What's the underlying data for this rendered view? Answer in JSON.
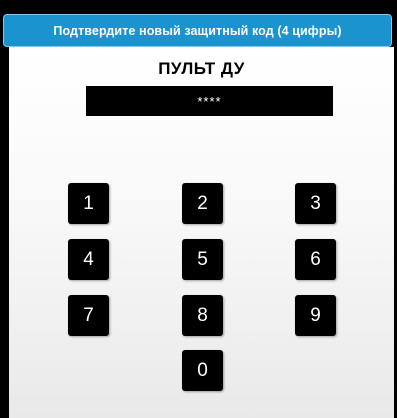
{
  "dialog": {
    "title": "Подтвердите новый защитный код (4 цифры)",
    "heading": "ПУЛЬТ ДУ",
    "code_value": "****"
  },
  "keypad": {
    "keys": [
      "1",
      "2",
      "3",
      "4",
      "5",
      "6",
      "7",
      "8",
      "9",
      "0"
    ]
  }
}
